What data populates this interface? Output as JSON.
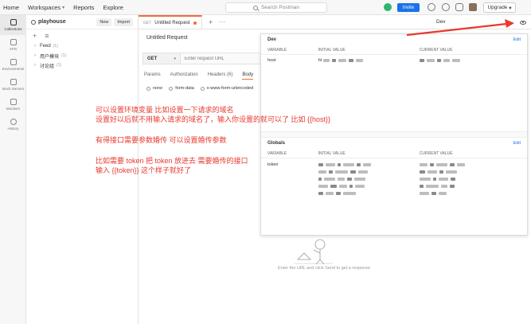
{
  "topbar": {
    "home": "Home",
    "workspaces": "Workspaces",
    "reports": "Reports",
    "explore": "Explore",
    "search_placeholder": "Search Postman",
    "invite": "Invite",
    "upgrade": "Upgrade"
  },
  "rail": [
    {
      "label": "Collections"
    },
    {
      "label": "APIs"
    },
    {
      "label": "Environments"
    },
    {
      "label": "Mock Servers"
    },
    {
      "label": "Monitors"
    },
    {
      "label": "History"
    }
  ],
  "sidebar": {
    "workspace": "playhouse",
    "new": "New",
    "import": "Import",
    "collections": [
      {
        "name": "Feed",
        "count": "(1)"
      },
      {
        "name": "用户模块",
        "count": "(1)"
      },
      {
        "name": "讨论组",
        "count": "(1)"
      }
    ]
  },
  "tab": {
    "method": "GET",
    "title": "Untitled Request"
  },
  "environment": "Dev",
  "request": {
    "title": "Untitled Request",
    "method": "GET",
    "url_placeholder": "Enter request URL",
    "tabs": [
      "Params",
      "Authorization",
      "Headers (6)",
      "Body"
    ],
    "body_types": [
      "none",
      "form-data",
      "x-www-form-urlencoded"
    ]
  },
  "env_panel": {
    "dev": {
      "title": "Dev",
      "edit": "Edit",
      "columns": [
        "VARIABLE",
        "INITIAL VALUE",
        "CURRENT VALUE"
      ],
      "rows": [
        {
          "variable": "host",
          "initial_prefix": "ht"
        }
      ]
    },
    "globals": {
      "title": "Globals",
      "edit": "Edit",
      "columns": [
        "VARIABLE",
        "INITIAL VALUE",
        "CURRENT VALUE"
      ],
      "rows": [
        {
          "variable": "token"
        }
      ]
    }
  },
  "annotation": {
    "line1": "可以设置环境变量 比如设置一下请求的域名",
    "line2": "设置好以后就不用输入请求的域名了，输入你设置的就可以了 比如 {{host}}",
    "line3": "有得接口需要参数婚传 可以设置婚传参数",
    "line4": "比如需要 token 把 token 放进去 需要婚传的接口",
    "line5": "输入 {{token}} 这个样子就好了"
  },
  "empty_state": "Enter the URL and click Send to get a response",
  "colors": {
    "accent": "#f26b3a",
    "annotation": "#e8392e",
    "invite": "#1a73e8"
  }
}
